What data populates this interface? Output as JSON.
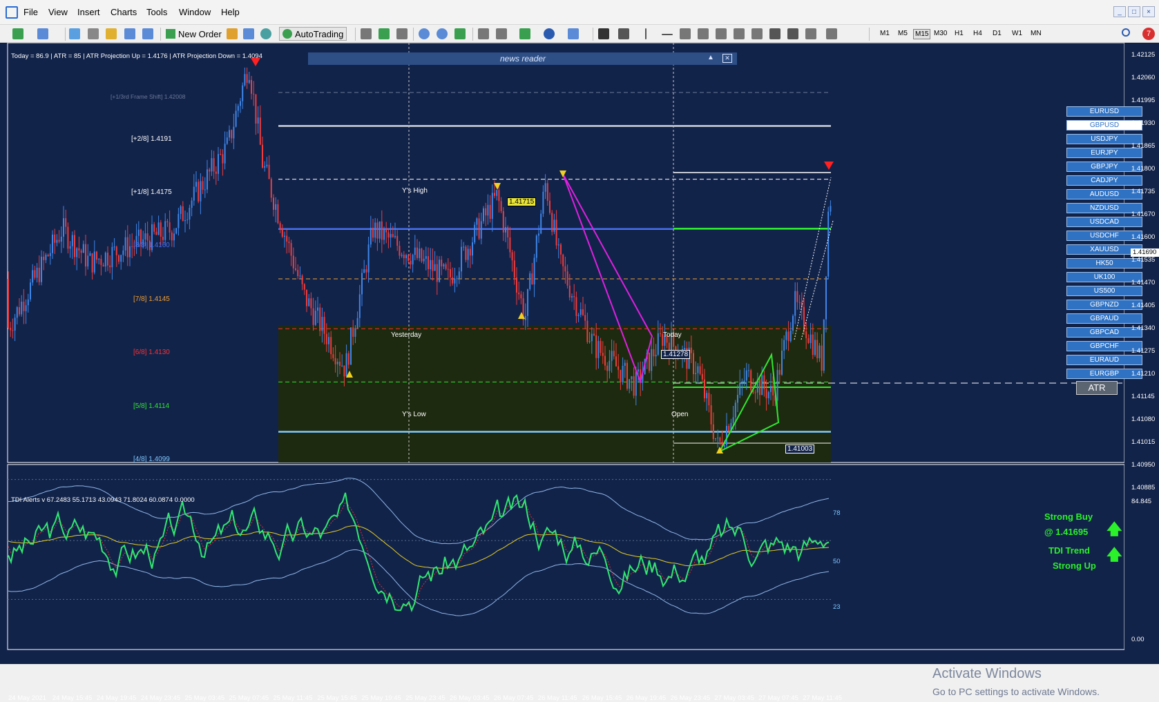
{
  "menubar": {
    "items": [
      "File",
      "View",
      "Insert",
      "Charts",
      "Tools",
      "Window",
      "Help"
    ]
  },
  "window_controls": [
    "_",
    "□",
    "×"
  ],
  "toolbar": {
    "new_order": "New Order",
    "autotrading": "AutoTrading",
    "timeframes": [
      "M1",
      "M5",
      "M15",
      "M30",
      "H1",
      "H4",
      "D1",
      "W1",
      "MN"
    ],
    "selected_timeframe": "M15",
    "notification_count": "7"
  },
  "chart": {
    "info_line": "Today = 86.9   |   ATR = 85   |   ATR Projection Up = 1.4176   |   ATR Projection Down = 1.4094",
    "news_reader": "news reader",
    "frame_shift": "[+1/3rd Frame Shift]  1.42008",
    "murrey": [
      {
        "label": "[+2/8]  1.4191",
        "price": 1.4191,
        "color": "#ffffff"
      },
      {
        "label": "[+1/8]  1.4175",
        "price": 1.4175,
        "color": "#ffffff"
      },
      {
        "label": "[8/8]  1.4160",
        "price": 1.416,
        "color": "#4a6ff0"
      },
      {
        "label": "[7/8]  1.4145",
        "price": 1.4145,
        "color": "#f0a030"
      },
      {
        "label": "[6/8]  1.4130",
        "price": 1.413,
        "color": "#ff3030"
      },
      {
        "label": "[5/8]  1.4114",
        "price": 1.4114,
        "color": "#30e830"
      },
      {
        "label": "[4/8]  1.4099",
        "price": 1.4099,
        "color": "#7fc9ff"
      }
    ],
    "session_labels": {
      "ys_high": "Y's High",
      "ys_low": "Y's Low",
      "yesterday": "Yesterday",
      "today": "Today",
      "open": "Open"
    },
    "price_tags": [
      "1.41715",
      "1.41278",
      "1.41003"
    ],
    "current_price": "1.41690",
    "price_axis": [
      "1.42125",
      "1.42060",
      "1.41995",
      "1.41930",
      "1.41865",
      "1.41800",
      "1.41735",
      "1.41670",
      "1.41600",
      "1.41535",
      "1.41470",
      "1.41405",
      "1.41340",
      "1.41275",
      "1.41210",
      "1.41145",
      "1.41080",
      "1.41015",
      "1.40950",
      "1.40885"
    ],
    "pairs": [
      "EURUSD",
      "GBPUSD",
      "USDJPY",
      "EURJPY",
      "GBPJPY",
      "CADJPY",
      "AUDUSD",
      "NZDUSD",
      "USDCAD",
      "USDCHF",
      "XAUUSD",
      "HK50",
      "UK100",
      "US500",
      "GBPNZD",
      "GBPAUD",
      "GBPCAD",
      "GBPCHF",
      "EURAUD",
      "EURGBP"
    ],
    "selected_pair": "GBPUSD",
    "atr_button": "ATR"
  },
  "indicator": {
    "title": "TDI Alerts v 67.2483 55.1713 43.0943 71.8024 60.0874 0.0000",
    "levels": [
      "78",
      "50",
      "23"
    ],
    "axis_top": "84.845",
    "axis_bottom": "0.00",
    "signals": {
      "strong_buy": "Strong Buy",
      "at_price": "@ 1.41695",
      "tdi_trend": "TDI Trend",
      "strong_up": "Strong Up"
    }
  },
  "time_axis": [
    "24 May 2021",
    "24 May 15:45",
    "24 May 19:45",
    "24 May 23:45",
    "25 May 03:45",
    "25 May 07:45",
    "25 May 11:45",
    "25 May 15:45",
    "25 May 19:45",
    "25 May 23:45",
    "26 May 03:45",
    "26 May 07:45",
    "26 May 11:45",
    "26 May 15:45",
    "26 May 19:45",
    "26 May 23:45",
    "27 May 03:45",
    "27 May 07:45",
    "27 May 11:45"
  ],
  "watermark": {
    "line1": "Activate Windows",
    "line2": "Go to PC settings to activate Windows."
  }
}
